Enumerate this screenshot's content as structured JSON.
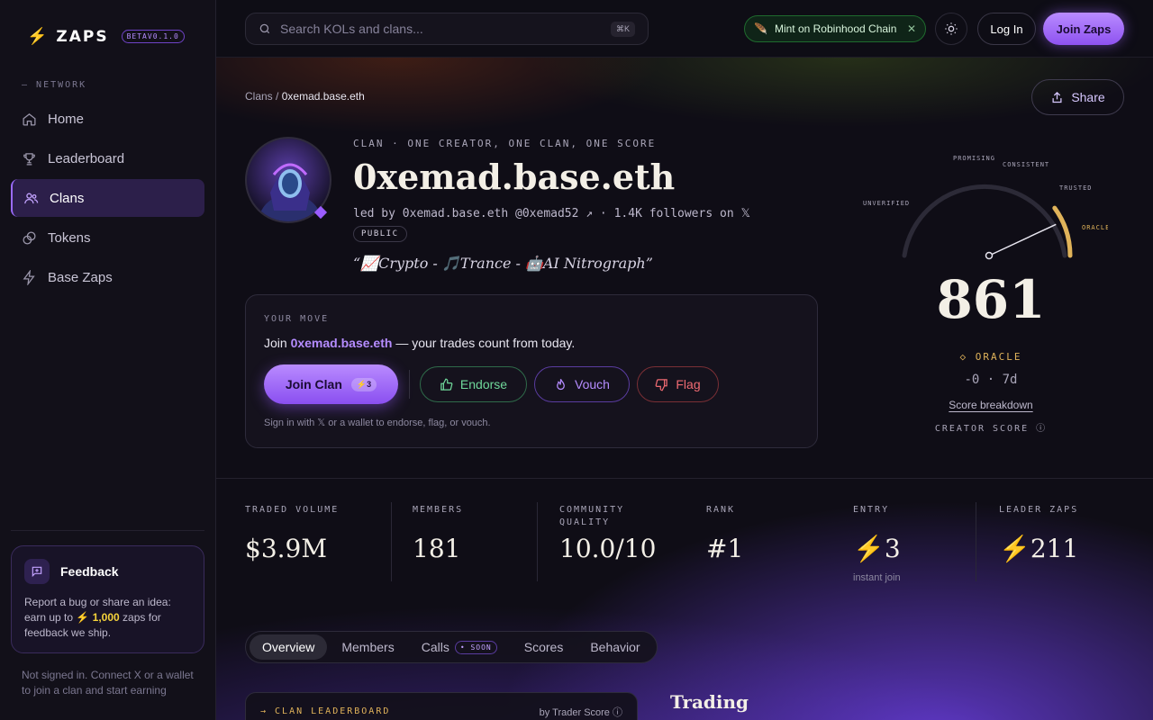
{
  "brand": {
    "name": "ZAPS",
    "version": "BETAV0.1.0"
  },
  "sidebar": {
    "section": "NETWORK",
    "items": [
      {
        "label": "Home",
        "icon": "home-icon"
      },
      {
        "label": "Leaderboard",
        "icon": "trophy-icon"
      },
      {
        "label": "Clans",
        "icon": "users-icon",
        "active": true
      },
      {
        "label": "Tokens",
        "icon": "coins-icon"
      },
      {
        "label": "Base Zaps",
        "icon": "bolt-icon"
      }
    ],
    "feedback": {
      "title": "Feedback",
      "text_pre": "Report a bug or share an idea: earn up to",
      "amount": "1,000",
      "text_post": "zaps for feedback we ship."
    },
    "not_signed": "Not signed in. Connect X or a wallet to join a clan and start earning"
  },
  "topbar": {
    "search_placeholder": "Search KOLs and clans...",
    "shortcut": "⌘K",
    "mint": "Mint on Robinhood Chain",
    "login": "Log In",
    "join": "Join Zaps"
  },
  "breadcrumb": {
    "root": "Clans",
    "sep": "/",
    "current": "0xemad.base.eth"
  },
  "share": "Share",
  "clan": {
    "tagline": "CLAN · ONE CREATOR, ONE CLAN, ONE SCORE",
    "name": "0xemad.base.eth",
    "led_by": "led by 0xemad.base.eth @0xemad52 ↗ · 1.4K followers on 𝕏",
    "visibility": "PUBLIC",
    "quote": "“📈Crypto - 🎵Trance - 🤖AI Nitrograph”"
  },
  "move": {
    "label": "YOUR MOVE",
    "text_pre": "Join",
    "text_hl": "0xemad.base.eth",
    "text_post": "— your trades count from today.",
    "join_label": "Join Clan",
    "join_cost": "⚡3",
    "endorse": "Endorse",
    "vouch": "Vouch",
    "flag": "Flag",
    "footer": "Sign in with 𝕏 or a wallet to endorse, flag, or vouch."
  },
  "gauge": {
    "tiers": [
      "UNVERIFIED",
      "PROMISING",
      "CONSISTENT",
      "TRUSTED",
      "ORACLE"
    ],
    "score": "861",
    "tier": "◇ ORACLE",
    "delta": "-0 · 7d",
    "breakdown": "Score breakdown",
    "caption": "CREATOR SCORE ⓘ",
    "value": 861,
    "max": 1000
  },
  "stats": [
    {
      "label": "TRADED VOLUME",
      "value": "$3.9M"
    },
    {
      "label": "MEMBERS",
      "value": "181"
    },
    {
      "label": "COMMUNITY QUALITY",
      "value": "10.0/10"
    },
    {
      "label": "RANK",
      "value": "#1"
    },
    {
      "label": "ENTRY",
      "value": "⚡3",
      "sub": "instant join"
    },
    {
      "label": "LEADER ZAPS",
      "value": "⚡211"
    }
  ],
  "tabs": [
    {
      "label": "Overview",
      "active": true
    },
    {
      "label": "Members"
    },
    {
      "label": "Calls",
      "badge": "• SOON"
    },
    {
      "label": "Scores"
    },
    {
      "label": "Behavior"
    }
  ],
  "leaderboard": {
    "title": "→ CLAN LEADERBOARD",
    "by": "by Trader Score ⓘ"
  },
  "trading_title": "Trading",
  "colors": {
    "accent": "#9b6bff",
    "gold": "#e0b35a",
    "green": "#6fd79a",
    "red": "#f06b72"
  }
}
